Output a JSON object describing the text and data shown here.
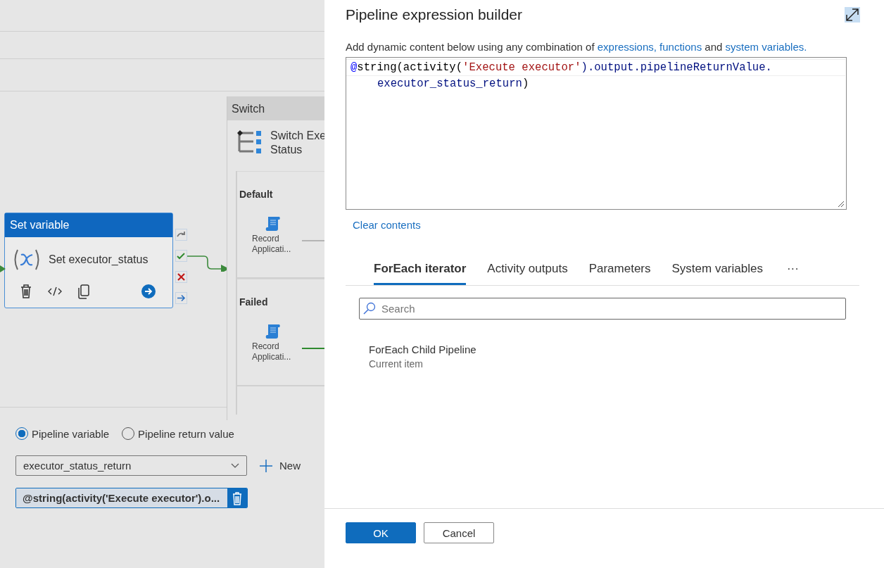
{
  "canvas": {
    "set_variable": {
      "header": "Set variable",
      "name": "Set executor_status"
    },
    "switch": {
      "header": "Switch",
      "name_lines": [
        "Switch Exe",
        "Status"
      ],
      "cases": [
        {
          "label": "Default",
          "activity": "Record Applicati...",
          "color": "#b4b4b4"
        },
        {
          "label": "Failed",
          "activity": "Record Applicati...",
          "color": "#2f8a2f"
        }
      ]
    }
  },
  "properties": {
    "radios": [
      {
        "label": "Pipeline variable",
        "selected": true
      },
      {
        "label": "Pipeline return value",
        "selected": false
      }
    ],
    "variable_dropdown": {
      "value": "executor_status_return"
    },
    "new_button": "New",
    "value_chip": "@string(activity('Execute executor').o..."
  },
  "expression_builder": {
    "title": "Pipeline expression builder",
    "description": [
      {
        "kind": "text",
        "text": "Add dynamic content below using any combination of "
      },
      {
        "kind": "link",
        "text": "expressions, functions"
      },
      {
        "kind": "text",
        "text": " and "
      },
      {
        "kind": "link",
        "text": "system variables."
      }
    ],
    "code_lines": [
      [
        {
          "kind": "at",
          "text": "@"
        },
        {
          "kind": "plain",
          "text": "string(activity("
        },
        {
          "kind": "string",
          "text": "'Execute executor'"
        },
        {
          "kind": "member",
          "text": ").output.pipelineReturnValue."
        }
      ],
      [
        {
          "kind": "member",
          "text": "executor_status_return"
        },
        {
          "kind": "plain",
          "text": ")"
        }
      ]
    ],
    "clear_link": "Clear contents",
    "tabs": [
      {
        "label": "ForEach iterator",
        "selected": true
      },
      {
        "label": "Activity outputs",
        "selected": false
      },
      {
        "label": "Parameters",
        "selected": false
      },
      {
        "label": "System variables",
        "selected": false
      }
    ],
    "more": "···",
    "search": {
      "placeholder": "Search"
    },
    "items": [
      {
        "title": "ForEach Child Pipeline",
        "subtitle": "Current item"
      }
    ],
    "buttons": [
      {
        "label": "OK",
        "kind": "primary"
      },
      {
        "label": "Cancel",
        "kind": "secondary"
      }
    ]
  }
}
